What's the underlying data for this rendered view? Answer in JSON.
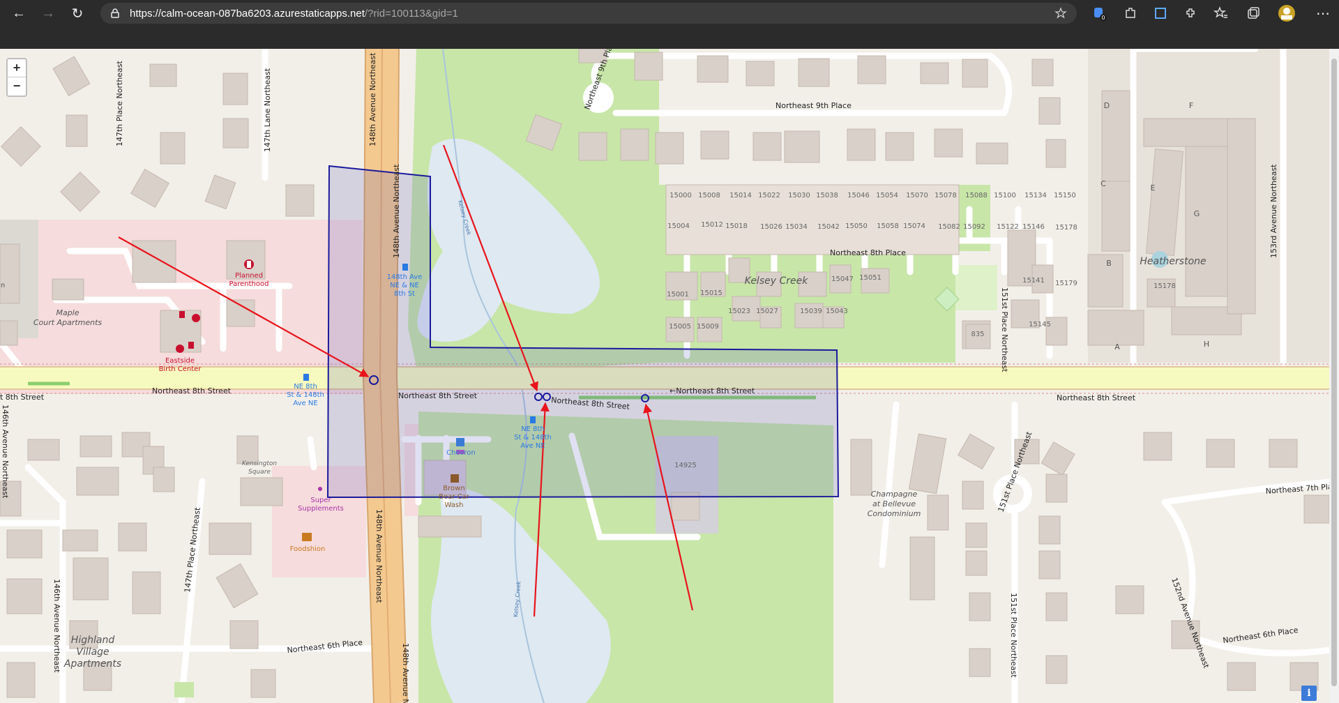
{
  "browser": {
    "url_host": "https://calm-ocean-087ba6203.azurestaticapps.net",
    "url_rest": "/?rid=100113&gid=1",
    "badge_count": "0"
  },
  "map_controls": {
    "zoom_in": "+",
    "zoom_out": "−",
    "info": "i"
  },
  "streets": {
    "ne_8th_left": "t 8th Street",
    "ne_8th_a": "Northeast 8th Street",
    "ne_8th_b": "Northeast 8th Street",
    "ne_8th_c": "Northeast 8th Street",
    "ne_8th_d": "←Northeast 8th Street",
    "ne_8th_e": "Northeast 8th Street",
    "ne_8th_place": "Northeast 8th Place",
    "ne_9th_place": "Northeast 9th Place",
    "ne_9th_place_curve": "Northeast 9th Place",
    "ne_7th": "Northeast 7th Pla",
    "ne_6th_place_left": "Northeast 6th Place",
    "ne_6th_place_right": "Northeast 6th Place",
    "ave148_top": "148th Avenue Northeast",
    "ave148_mid": "148th Avenue Northeast",
    "ave148_low": "148th Avenue Northeast",
    "ave148_bottom": "148th Avenue N",
    "ave147_place": "147th Place Northeast",
    "ave147_lane": "147th Lane Northeast",
    "ave147_place_low": "147th Place Northeast",
    "ave146_left": "146th Avenue Northeast",
    "ave146_low": "146th Avenue Northeast",
    "ave151_place": "151st Place Northeast",
    "ave151_place_low": "151st Place Northeast",
    "ave151_circle": "151st Place Northeast",
    "ave152": "152nd Avenue Northeast",
    "ave153": "153rd Avenue Northeast",
    "kelsey_creek_stream": "Kelsey Creek",
    "kelsey_creek_stream_low": "Kelsey Creek"
  },
  "places": {
    "kelsey_creek": "Kelsey Creek",
    "heatherstone": "Heatherstone",
    "maple_court_1": "Maple",
    "maple_court_2": "Court Apartments",
    "planned_parenthood_1": "Planned",
    "planned_parenthood_2": "Parenthood",
    "eastside_1": "Eastside",
    "eastside_2": "Birth Center",
    "bus_stop_nw_1": "NE 8th",
    "bus_stop_nw_2": "St & 148th",
    "bus_stop_nw_3": "Ave NE",
    "bus_stop_n_1": "148th Ave",
    "bus_stop_n_2": "NE & NE",
    "bus_stop_n_3": "8th St",
    "bus_stop_s_1": "NE 8th",
    "bus_stop_s_2": "St & 148th",
    "bus_stop_s_3": "Ave NE",
    "chevron": "Chevron",
    "brown_bear_1": "Brown",
    "brown_bear_2": "Bear Car",
    "brown_bear_3": "Wash",
    "kensington_1": "Kensington",
    "kensington_2": "Square",
    "super_supp_1": "Super",
    "super_supp_2": "Supplements",
    "foodshion": "Foodshion",
    "champagne_1": "Champagne",
    "champagne_2": "at Bellevue",
    "champagne_3": "Condominium",
    "highland_1": "Highland",
    "highland_2": "Village",
    "highland_3": "Apartments",
    "n_partial": "n"
  },
  "house_numbers_top": [
    "15000",
    "15008",
    "15014",
    "15022",
    "15030",
    "15038",
    "15046",
    "15054",
    "15070",
    "15078",
    "15088",
    "15100",
    "15134",
    "15150"
  ],
  "house_numbers_mid": [
    "15004",
    "15012",
    "15018",
    "15026",
    "15034",
    "15042",
    "15050",
    "15058",
    "15074",
    "15082",
    "15092",
    "15122",
    "15146",
    "15178"
  ],
  "house_numbers_misc": {
    "h15001": "15001",
    "h15015": "15015",
    "h15005": "15005",
    "h15009": "15009",
    "h15023": "15023",
    "h15027": "15027",
    "h15039": "15039",
    "h15043": "15043",
    "h15047": "15047",
    "h15051": "15051",
    "h15141": "15141",
    "h15179": "15179",
    "h15145": "15145",
    "h835": "835",
    "h14925": "14925",
    "h15178b": "15178"
  },
  "building_letters": [
    "D",
    "F",
    "C",
    "E",
    "G",
    "B",
    "A",
    "H"
  ],
  "colors": {
    "arrow": "#e8141c",
    "selection_box": "#1a1a9c",
    "marker": "#1a1a9c",
    "major_road": "#f7fabf",
    "trunk_road": "#f3c990",
    "park": "#c8e6a8",
    "wetland": "#dfe9f2",
    "building": "#d9d0c9",
    "medical_area": "#f6dcdc"
  }
}
